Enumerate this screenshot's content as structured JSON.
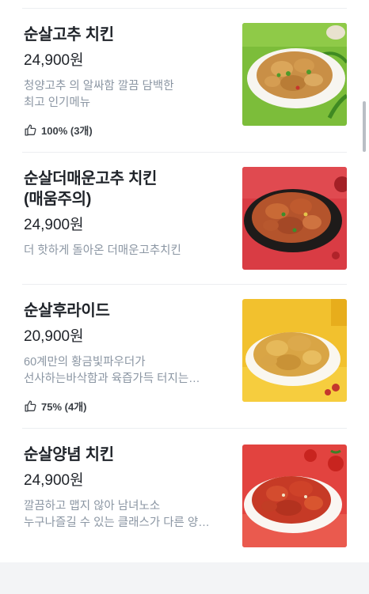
{
  "menu": {
    "items": [
      {
        "name_lines": [
          "순살고추 치킨"
        ],
        "price": "24,900원",
        "desc_lines": [
          "청양고추 의 알싸함 깔끔 담백한",
          "최고 인기메뉴"
        ],
        "review": "100% (3개)",
        "photo": "fried chicken with green chili on green background"
      },
      {
        "name_lines": [
          "순살더매운고추 치킨",
          "(매움주의)"
        ],
        "price": "24,900원",
        "desc_lines": [
          "더 핫하게 돌아온 더매운고추치킨"
        ],
        "review": null,
        "photo": "spicy chicken on black plate, red background"
      },
      {
        "name_lines": [
          "순살후라이드"
        ],
        "price": "20,900원",
        "desc_lines": [
          "60계만의 황금빛파우더가",
          "선사하는바삭함과 육즙가득 터지는…"
        ],
        "review": "75% (4개)",
        "photo": "golden fried chicken on yellow background"
      },
      {
        "name_lines": [
          "순살양념 치킨"
        ],
        "price": "24,900원",
        "desc_lines": [
          "깔끔하고 맵지 않아 남녀노소",
          "누구나즐길 수 있는 클래스가 다른 양…"
        ],
        "review": null,
        "photo": "sauced chicken with tomatoes on red background"
      }
    ]
  },
  "colors": {
    "text_primary": "#1f2329",
    "text_secondary": "#8b96a3",
    "divider": "#eceef1"
  }
}
